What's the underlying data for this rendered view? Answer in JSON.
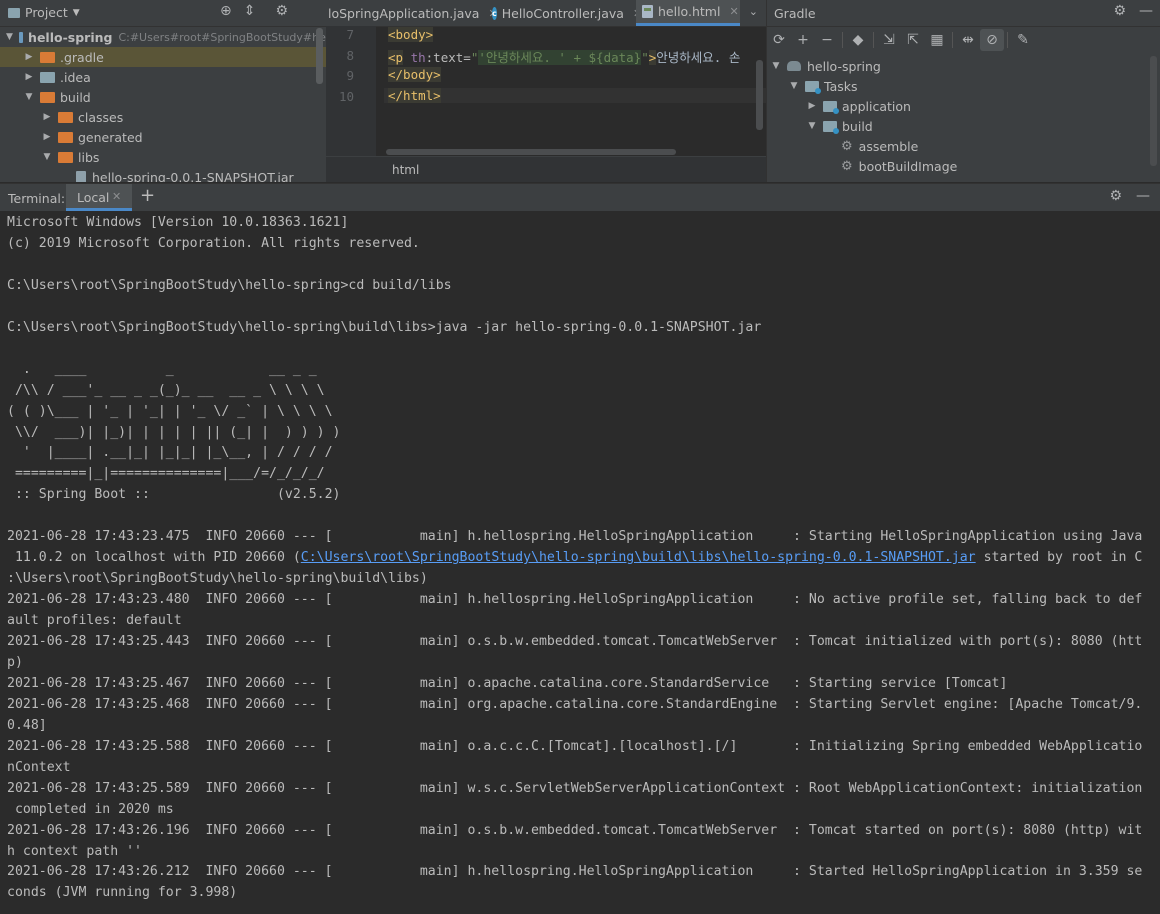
{
  "project": {
    "title": "Project",
    "tree": [
      {
        "label": "hello-spring",
        "hint": "C:#Users#root#SpringBootStudy#hell",
        "depth": 0,
        "expanded": true,
        "type": "module"
      },
      {
        "label": ".gradle",
        "depth": 1,
        "expanded": false,
        "type": "folder-orange",
        "selected": true
      },
      {
        "label": ".idea",
        "depth": 1,
        "expanded": false,
        "type": "folder-grey"
      },
      {
        "label": "build",
        "depth": 1,
        "expanded": true,
        "type": "folder-orange"
      },
      {
        "label": "classes",
        "depth": 2,
        "expanded": false,
        "type": "folder-orange"
      },
      {
        "label": "generated",
        "depth": 2,
        "expanded": false,
        "type": "folder-orange"
      },
      {
        "label": "libs",
        "depth": 2,
        "expanded": true,
        "type": "folder-orange"
      },
      {
        "label": "hello-spring-0.0.1-SNAPSHOT.jar",
        "depth": 3,
        "type": "jar"
      }
    ]
  },
  "editor": {
    "tabs": [
      {
        "label": "loSpringApplication.java",
        "icon": "class-icon",
        "active": false
      },
      {
        "label": "HelloController.java",
        "icon": "class-icon",
        "active": false
      },
      {
        "label": "hello.html",
        "icon": "html-file-icon",
        "active": true
      }
    ],
    "line_numbers": [
      "7",
      "8",
      "9",
      "10"
    ],
    "code": {
      "l7_tag": "<body>",
      "l8_open": "<p",
      "l8_ns": "th",
      "l8_attr": ":text=",
      "l8_q1": "\"",
      "l8_str": "'안녕하세요. ' + ${data}",
      "l8_q2": "\"",
      "l8_close": ">",
      "l8_text": "안녕하세요. 손",
      "l9_tag": "</body>",
      "l10_tag": "</html>"
    },
    "breadcrumb": "html"
  },
  "gradle": {
    "title": "Gradle",
    "tree": [
      {
        "label": "hello-spring",
        "depth": 0,
        "expanded": true,
        "type": "elephant"
      },
      {
        "label": "Tasks",
        "depth": 1,
        "expanded": true,
        "type": "taskfolder"
      },
      {
        "label": "application",
        "depth": 2,
        "expanded": false,
        "type": "taskfolder"
      },
      {
        "label": "build",
        "depth": 2,
        "expanded": true,
        "type": "taskfolder"
      },
      {
        "label": "assemble",
        "depth": 3,
        "type": "task"
      },
      {
        "label": "bootBuildImage",
        "depth": 3,
        "type": "task"
      }
    ]
  },
  "terminal": {
    "label": "Terminal:",
    "tab": "Local",
    "lines": [
      "Microsoft Windows [Version 10.0.18363.1621]",
      "(c) 2019 Microsoft Corporation. All rights reserved.",
      "",
      "C:\\Users\\root\\SpringBootStudy\\hello-spring>cd build/libs",
      "",
      "C:\\Users\\root\\SpringBootStudy\\hello-spring\\build\\libs>java -jar hello-spring-0.0.1-SNAPSHOT.jar",
      "",
      "  .   ____          _            __ _ _",
      " /\\\\ / ___'_ __ _ _(_)_ __  __ _ \\ \\ \\ \\",
      "( ( )\\___ | '_ | '_| | '_ \\/ _` | \\ \\ \\ \\",
      " \\\\/  ___)| |_)| | | | | || (_| |  ) ) ) )",
      "  '  |____| .__|_| |_|_| |_\\__, | / / / /",
      " =========|_|==============|___/=/_/_/_/",
      " :: Spring Boot ::                (v2.5.2)",
      "",
      "2021-06-28 17:43:23.475  INFO 20660 --- [           main] h.hellospring.HelloSpringApplication     : Starting HelloSpringApplication using Java",
      "@@LINK@@",
      ":\\Users\\root\\SpringBootStudy\\hello-spring\\build\\libs)",
      "2021-06-28 17:43:23.480  INFO 20660 --- [           main] h.hellospring.HelloSpringApplication     : No active profile set, falling back to def",
      "ault profiles: default",
      "2021-06-28 17:43:25.443  INFO 20660 --- [           main] o.s.b.w.embedded.tomcat.TomcatWebServer  : Tomcat initialized with port(s): 8080 (htt",
      "p)",
      "2021-06-28 17:43:25.467  INFO 20660 --- [           main] o.apache.catalina.core.StandardService   : Starting service [Tomcat]",
      "2021-06-28 17:43:25.468  INFO 20660 --- [           main] org.apache.catalina.core.StandardEngine  : Starting Servlet engine: [Apache Tomcat/9.",
      "0.48]",
      "2021-06-28 17:43:25.588  INFO 20660 --- [           main] o.a.c.c.C.[Tomcat].[localhost].[/]       : Initializing Spring embedded WebApplicatio",
      "nContext",
      "2021-06-28 17:43:25.589  INFO 20660 --- [           main] w.s.c.ServletWebServerApplicationContext : Root WebApplicationContext: initialization",
      " completed in 2020 ms",
      "2021-06-28 17:43:26.196  INFO 20660 --- [           main] o.s.b.w.embedded.tomcat.TomcatWebServer  : Tomcat started on port(s): 8080 (http) wit",
      "h context path ''",
      "2021-06-28 17:43:26.212  INFO 20660 --- [           main] h.hellospring.HelloSpringApplication     : Started HelloSpringApplication in 3.359 se",
      "conds (JVM running for 3.998)"
    ],
    "link_line": {
      "prefix": " 11.0.2 on localhost with PID 20660 (",
      "link": "C:\\Users\\root\\SpringBootStudy\\hello-spring\\build\\libs\\hello-spring-0.0.1-SNAPSHOT.jar",
      "suffix": " started by root in C"
    }
  }
}
